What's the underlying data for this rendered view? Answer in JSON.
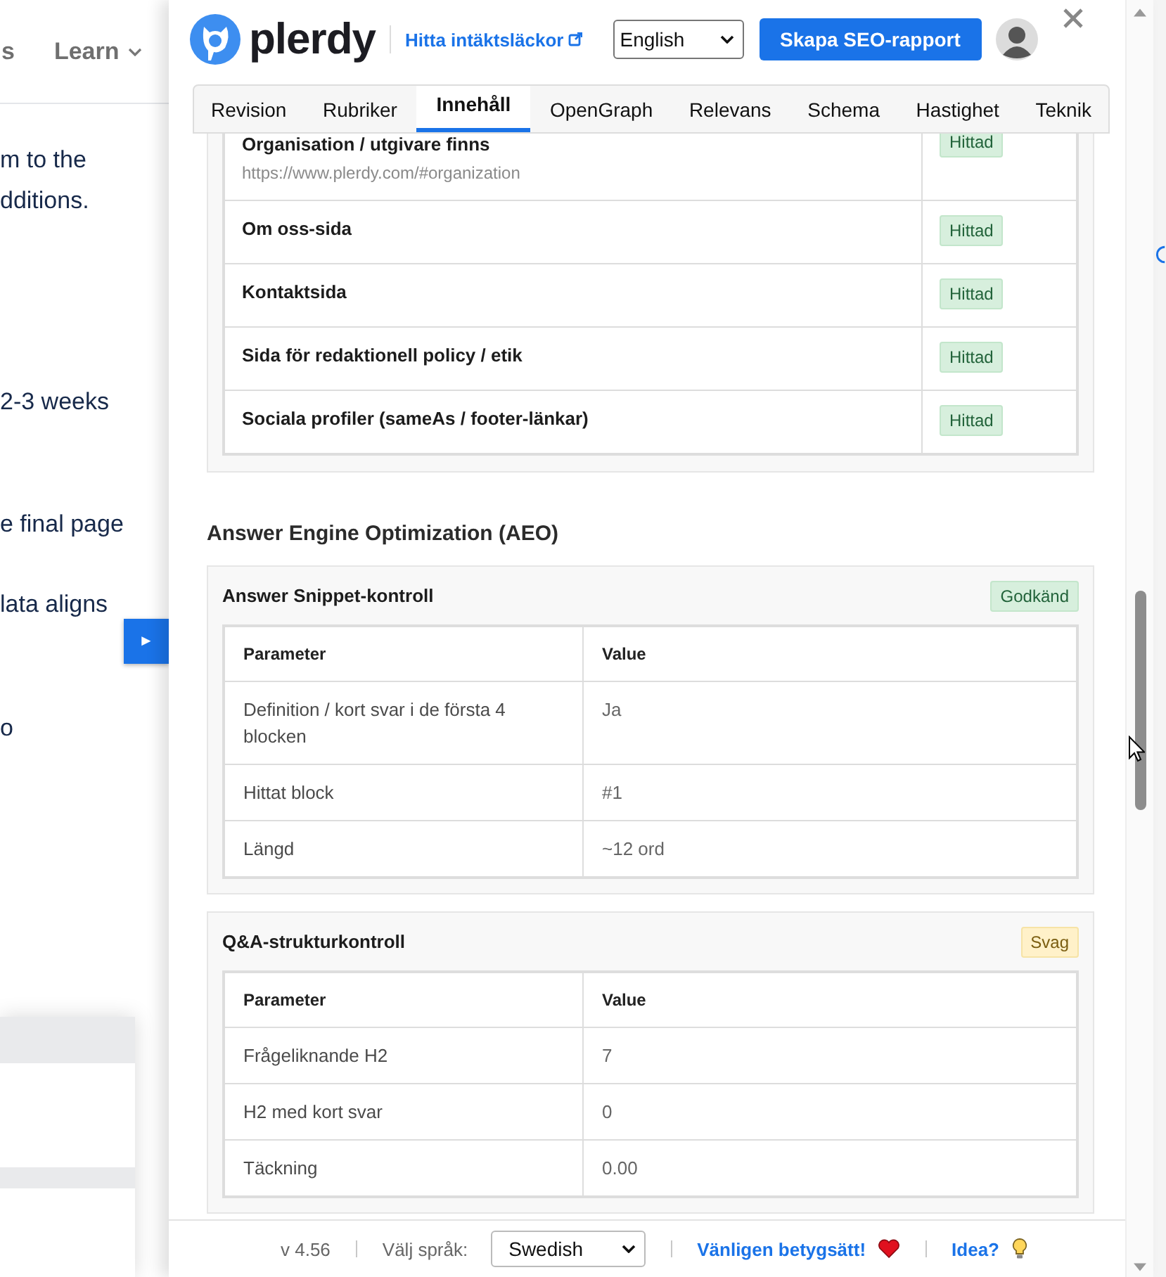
{
  "background_page": {
    "nav": [
      "s",
      "Learn"
    ],
    "paragraphs": [
      "m to the",
      "dditions.",
      "2-3 weeks",
      "e final page",
      "lata aligns",
      "o"
    ],
    "toggle_button": "►"
  },
  "header": {
    "logo": "plerdy",
    "link": "Hitta intäktsläckor",
    "language": "English",
    "cta": "Skapa SEO-rapport"
  },
  "tabs": [
    {
      "label": "Revision",
      "selected": false
    },
    {
      "label": "Rubriker",
      "selected": false
    },
    {
      "label": "Innehåll",
      "selected": true
    },
    {
      "label": "OpenGraph",
      "selected": false
    },
    {
      "label": "Relevans",
      "selected": false
    },
    {
      "label": "Schema",
      "selected": false
    },
    {
      "label": "Hastighet",
      "selected": false
    },
    {
      "label": "Teknik",
      "selected": false
    }
  ],
  "checks_table": {
    "rows": [
      {
        "label": "Organisation / utgivare finns",
        "url": "https://www.plerdy.com/#organization",
        "status": {
          "text": "Hittad",
          "kind": "pass"
        }
      },
      {
        "label": "Om oss-sida",
        "status": {
          "text": "Hittad",
          "kind": "pass"
        }
      },
      {
        "label": "Kontaktsida",
        "status": {
          "text": "Hittad",
          "kind": "pass"
        }
      },
      {
        "label": "Sida för redaktionell policy / etik",
        "status": {
          "text": "Hittad",
          "kind": "pass"
        }
      },
      {
        "label": "Sociala profiler (sameAs / footer-länkar)",
        "status": {
          "text": "Hittad",
          "kind": "pass"
        }
      }
    ]
  },
  "section_title": "Answer Engine Optimization (AEO)",
  "cards": [
    {
      "title": "Answer Snippet-kontroll",
      "badge": {
        "text": "Godkänd",
        "kind": "pass"
      },
      "columns": [
        "Parameter",
        "Value"
      ],
      "rows": [
        [
          "Definition / kort svar i de första 4 blocken",
          "Ja"
        ],
        [
          "Hittat block",
          "#1"
        ],
        [
          "Längd",
          "~12 ord"
        ]
      ]
    },
    {
      "title": "Q&A-strukturkontroll",
      "badge": {
        "text": "Svag",
        "kind": "weak"
      },
      "columns": [
        "Parameter",
        "Value"
      ],
      "rows": [
        [
          "Frågeliknande H2",
          "7"
        ],
        [
          "H2 med kort svar",
          "0"
        ],
        [
          "Täckning",
          "0.00"
        ]
      ]
    }
  ],
  "footer": {
    "version": "v 4.56",
    "language_label": "Välj språk:",
    "language": "Swedish",
    "rate_link": "Vänligen betygsätt!",
    "idea_link": "Idea?"
  }
}
